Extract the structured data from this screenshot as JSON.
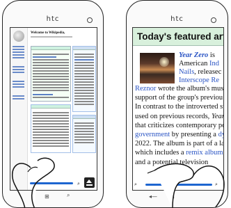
{
  "device": {
    "brand_left": "htc",
    "brand_right": "htc"
  },
  "left_screen": {
    "page_title": "Welcome to Wikipedia,"
  },
  "right_screen": {
    "section_title": "Today's featured articl",
    "lines": [
      {
        "parts": [
          {
            "t": "Year Zero",
            "s": "bl"
          },
          {
            "t": " is",
            "s": ""
          }
        ]
      },
      {
        "parts": [
          {
            "t": "American ",
            "s": ""
          },
          {
            "t": "Ind",
            "s": "lnk"
          }
        ]
      },
      {
        "parts": [
          {
            "t": "Nails",
            "s": "lnk"
          },
          {
            "t": ", releasec",
            "s": ""
          }
        ]
      },
      {
        "parts": [
          {
            "t": "Interscope Re",
            "s": "lnk"
          }
        ]
      },
      {
        "parts": [
          {
            "t": "Reznor",
            "s": "lnk"
          },
          {
            "t": " wrote the album's musi",
            "s": ""
          }
        ]
      },
      {
        "parts": [
          {
            "t": "support of the group's previou",
            "s": ""
          }
        ]
      },
      {
        "parts": [
          {
            "t": "In contrast to the introverted st",
            "s": ""
          }
        ]
      },
      {
        "parts": [
          {
            "t": "used on previous records, ",
            "s": ""
          },
          {
            "t": "Year",
            "s": "it"
          }
        ]
      },
      {
        "parts": [
          {
            "t": "that criticizes contemporary po",
            "s": ""
          }
        ]
      },
      {
        "parts": [
          {
            "t": "government",
            "s": "lnk"
          },
          {
            "t": " by presenting a ",
            "s": ""
          },
          {
            "t": "dy",
            "s": "lnk"
          }
        ]
      },
      {
        "parts": [
          {
            "t": "2022. The album is part of a la",
            "s": ""
          }
        ]
      },
      {
        "parts": [
          {
            "t": "which includes a ",
            "s": ""
          },
          {
            "t": "remix album",
            "s": "lnk"
          }
        ]
      },
      {
        "parts": [
          {
            "t": "and a potential television ",
            "s": ""
          }
        ]
      }
    ]
  },
  "colors": {
    "scroll_indicator": "#1e66d0",
    "link": "#2a54c4",
    "featured_header_bg": "#d8f0dc"
  },
  "icons": {
    "zoom": "magnifier-icon",
    "pan": "pan-mode-icon",
    "back": "back-icon",
    "start": "windows-start-icon",
    "search": "search-icon"
  }
}
